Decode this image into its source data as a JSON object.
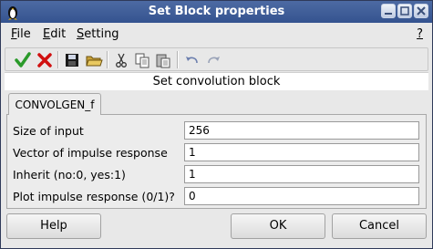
{
  "window": {
    "title": "Set Block properties"
  },
  "menubar": {
    "items": [
      {
        "label": "File",
        "mnemonic": "F",
        "rest": "ile"
      },
      {
        "label": "Edit",
        "mnemonic": "E",
        "rest": "dit"
      },
      {
        "label": "Setting",
        "mnemonic": "S",
        "rest": "etting"
      }
    ],
    "help_label": "?"
  },
  "toolbar": {
    "icons": [
      "ok-check-icon",
      "cancel-x-icon",
      "save-icon",
      "open-folder-icon",
      "cut-icon",
      "copy-icon",
      "paste-icon",
      "undo-icon",
      "redo-icon"
    ]
  },
  "header": {
    "text": "Set convolution block"
  },
  "tab": {
    "label": "CONVOLGEN_f"
  },
  "fields": [
    {
      "label": "Size of input",
      "value": "256"
    },
    {
      "label": "Vector of impulse response",
      "value": "1"
    },
    {
      "label": "Inherit (no:0, yes:1)",
      "value": "1"
    },
    {
      "label": "Plot impulse response (0/1)?",
      "value": "0"
    }
  ],
  "buttons": {
    "help": "Help",
    "ok": "OK",
    "cancel": "Cancel"
  },
  "colors": {
    "titlebar": "#3f5c98",
    "check": "#2a9a2a",
    "cross": "#d01010"
  }
}
